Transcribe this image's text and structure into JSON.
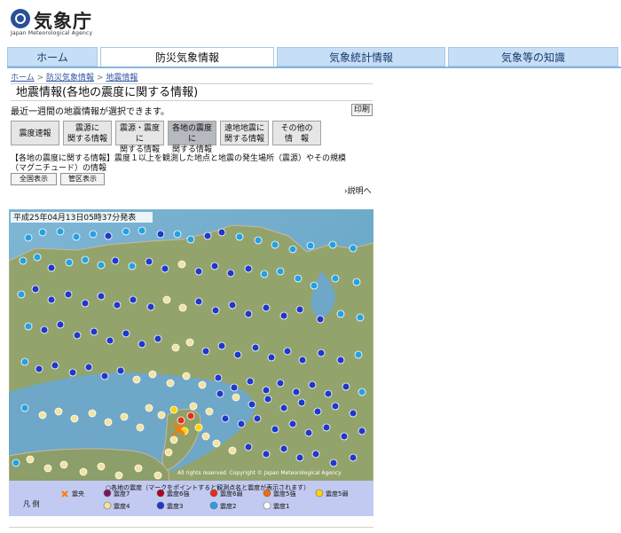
{
  "header": {
    "logo_text": "気象庁",
    "logo_en": "Japan Meteorological Agency"
  },
  "nav": {
    "tabs": [
      {
        "label": "ホーム"
      },
      {
        "label": "防災気象情報"
      },
      {
        "label": "気象統計情報"
      },
      {
        "label": "気象等の知識"
      }
    ]
  },
  "breadcrumb": {
    "home": "ホーム",
    "disaster": "防災気象情報",
    "earthquake": "地震情報"
  },
  "page": {
    "title": "地震情報(各地の震度に関する情報)",
    "description": "最近一週間の地震情報が選択できます。",
    "print": "印刷"
  },
  "subtabs": [
    {
      "line1": "震度速報",
      "line2": ""
    },
    {
      "line1": "震源に",
      "line2": "関する情報"
    },
    {
      "line1": "震源・震度に",
      "line2": "関する情報"
    },
    {
      "line1": "各地の震度に",
      "line2": "関する情報"
    },
    {
      "line1": "遠地地震に",
      "line2": "関する情報"
    },
    {
      "line1": "その他の",
      "line2": "情　報"
    }
  ],
  "info_text": "【各地の震度に関する情報】震度１以上を観測した地点と地震の発生場所（震源）やその規模（マグニチュード）の情報",
  "buttons": {
    "national": "全国表示",
    "district": "管区表示"
  },
  "explain": "説明へ",
  "map": {
    "timestamp": "平成25年04月13日05時37分発表",
    "copyright": "All rights reserved. Copyright © Japan Meteorological Agency"
  },
  "legend": {
    "header": "○各地の震度（マークをポイントすると観測点名と震度が表示されます）",
    "label": "凡 例",
    "epicenter": "震央",
    "items": [
      {
        "label": "震度7",
        "color": "#7e1463"
      },
      {
        "label": "震度6強",
        "color": "#b00020"
      },
      {
        "label": "震度6弱",
        "color": "#e72d18"
      },
      {
        "label": "震度5強",
        "color": "#f46a0b"
      },
      {
        "label": "震度5弱",
        "color": "#ffd400"
      },
      {
        "label": "震度4",
        "color": "#f4e39d"
      },
      {
        "label": "震度3",
        "color": "#1f39c8"
      },
      {
        "label": "震度2",
        "color": "#24a1e2"
      },
      {
        "label": "震度1",
        "color": "#ffffff"
      }
    ]
  }
}
